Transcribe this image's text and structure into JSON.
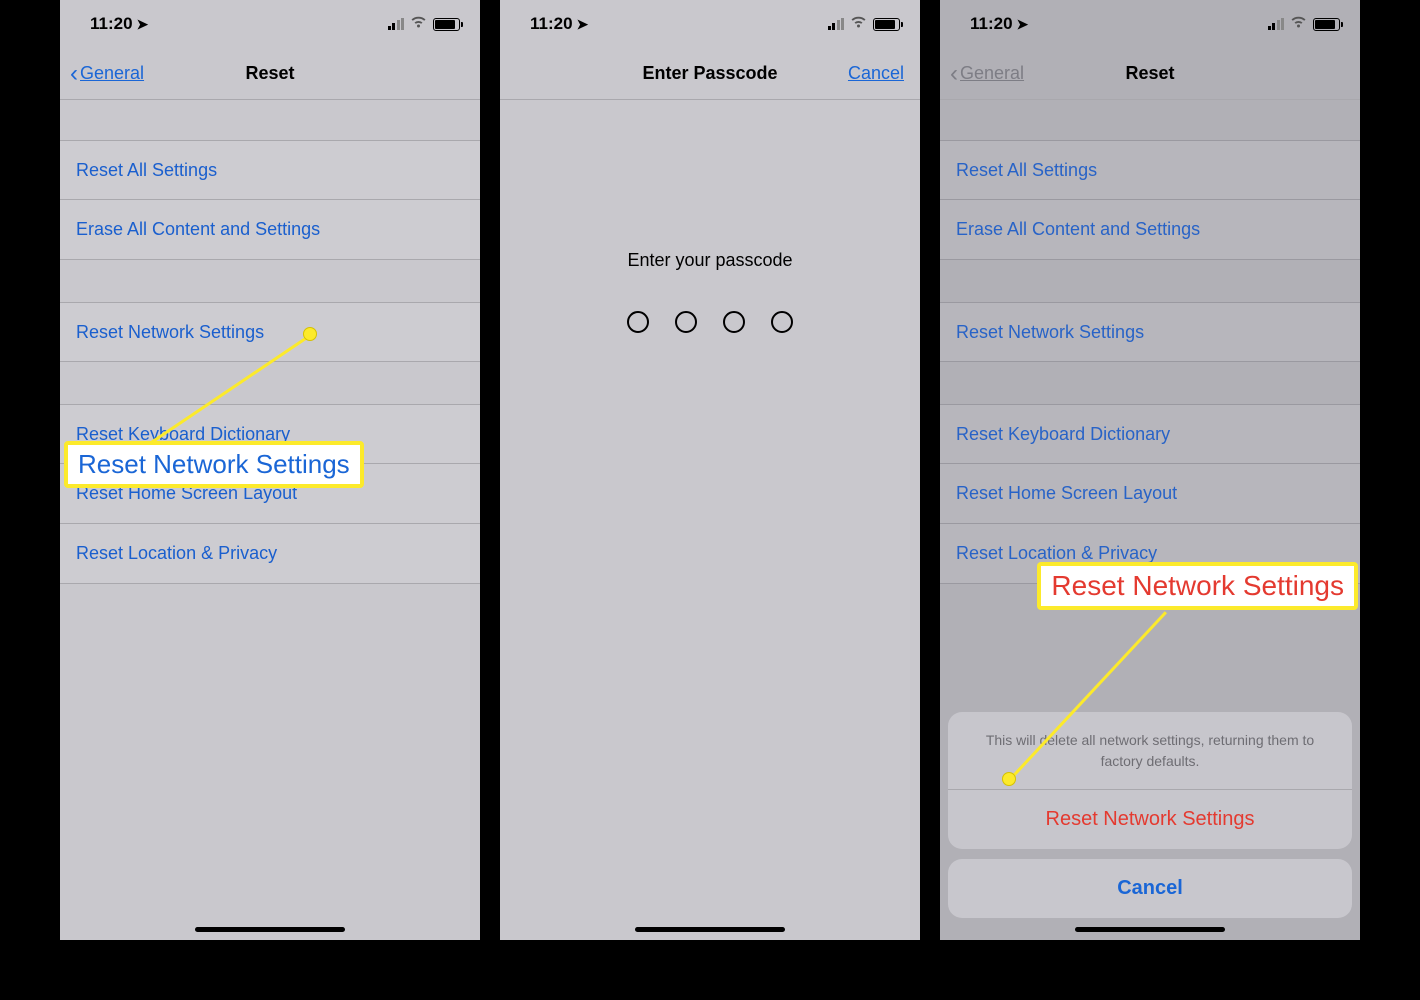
{
  "status": {
    "time": "11:20"
  },
  "screen1": {
    "back": "General",
    "title": "Reset",
    "rows": {
      "reset_all": "Reset All Settings",
      "erase_all": "Erase All Content and Settings",
      "network": "Reset Network Settings",
      "keyboard": "Reset Keyboard Dictionary",
      "home": "Reset Home Screen Layout",
      "location": "Reset Location & Privacy"
    },
    "callout_label": "Reset Network Settings"
  },
  "screen2": {
    "title": "Enter Passcode",
    "cancel": "Cancel",
    "prompt": "Enter your passcode"
  },
  "screen3": {
    "back": "General",
    "title": "Reset",
    "rows": {
      "reset_all": "Reset All Settings",
      "erase_all": "Erase All Content and Settings",
      "network": "Reset Network Settings",
      "keyboard": "Reset Keyboard Dictionary",
      "home": "Reset Home Screen Layout",
      "location": "Reset Location & Privacy"
    },
    "sheet": {
      "message": "This will delete all network settings, returning them to factory defaults.",
      "confirm": "Reset Network Settings",
      "cancel": "Cancel"
    },
    "callout_label": "Reset Network Settings"
  }
}
